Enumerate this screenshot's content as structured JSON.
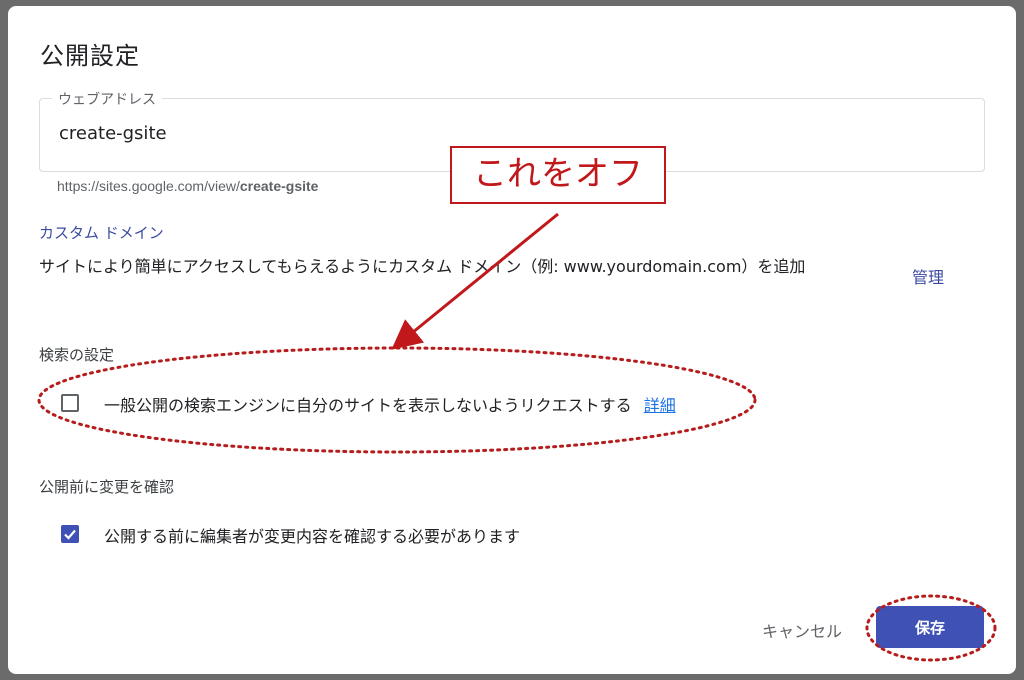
{
  "dialog": {
    "title": "公開設定",
    "web_address": {
      "label": "ウェブアドレス",
      "value": "create-gsite",
      "url_prefix": "https://sites.google.com/view/",
      "url_slug": "create-gsite"
    },
    "custom_domain": {
      "heading": "カスタム ドメイン",
      "description": "サイトにより簡単にアクセスしてもらえるようにカスタム ドメイン（例: www.yourdomain.com）を追加",
      "manage_label": "管理"
    },
    "search_settings": {
      "heading": "検索の設定",
      "checkbox_label": "一般公開の検索エンジンに自分のサイトを表示しないようリクエストする",
      "checked": false,
      "detail_label": "詳細"
    },
    "review_before_publish": {
      "heading": "公開前に変更を確認",
      "checkbox_label": "公開する前に編集者が変更内容を確認する必要があります",
      "checked": true
    },
    "actions": {
      "cancel_label": "キャンセル",
      "save_label": "保存"
    }
  },
  "annotation": {
    "callout_text": "これをオフ",
    "color": "#c0181b"
  },
  "colors": {
    "accent": "#3f51b5",
    "link": "#3b4aa0",
    "annotation": "#c0181b"
  },
  "icons": {
    "checkmark": "checkmark-icon"
  }
}
